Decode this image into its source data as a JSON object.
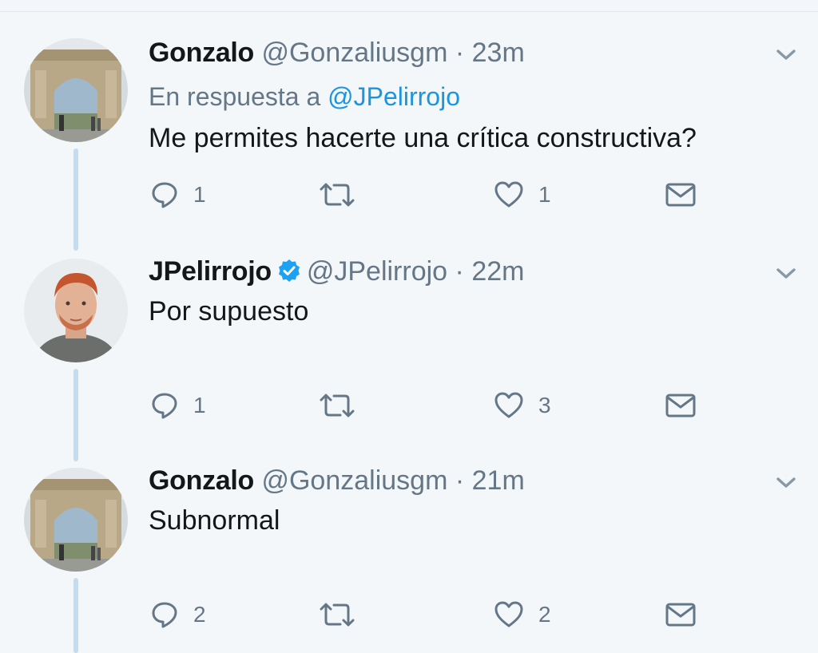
{
  "tweets": [
    {
      "name": "Gonzalo",
      "handle": "@Gonzaliusgm",
      "sep": "·",
      "time": "23m",
      "reply_prefix": "En respuesta a",
      "reply_handle": "@JPelirrojo",
      "text": "Me permites hacerte una crítica constructiva?",
      "replies": "1",
      "retweets": "",
      "likes": "1",
      "verified": false
    },
    {
      "name": "JPelirrojo",
      "handle": "@JPelirrojo",
      "sep": "·",
      "time": "22m",
      "text": "Por supuesto",
      "replies": "1",
      "retweets": "",
      "likes": "3",
      "verified": true
    },
    {
      "name": "Gonzalo",
      "handle": "@Gonzaliusgm",
      "sep": "·",
      "time": "21m",
      "text": "Subnormal",
      "replies": "2",
      "retweets": "",
      "likes": "2",
      "verified": false
    }
  ],
  "icons": {
    "reply": "reply-bubble-icon",
    "retweet": "retweet-arrows-icon",
    "like": "heart-icon",
    "dm": "envelope-icon",
    "more": "chevron-down-icon",
    "verified": "verified-badge-icon"
  },
  "colors": {
    "background": "#f3f7fa",
    "link": "#1b95e0",
    "verified": "#1da1f2",
    "muted": "#657786",
    "thread_line": "#c4dcee"
  }
}
